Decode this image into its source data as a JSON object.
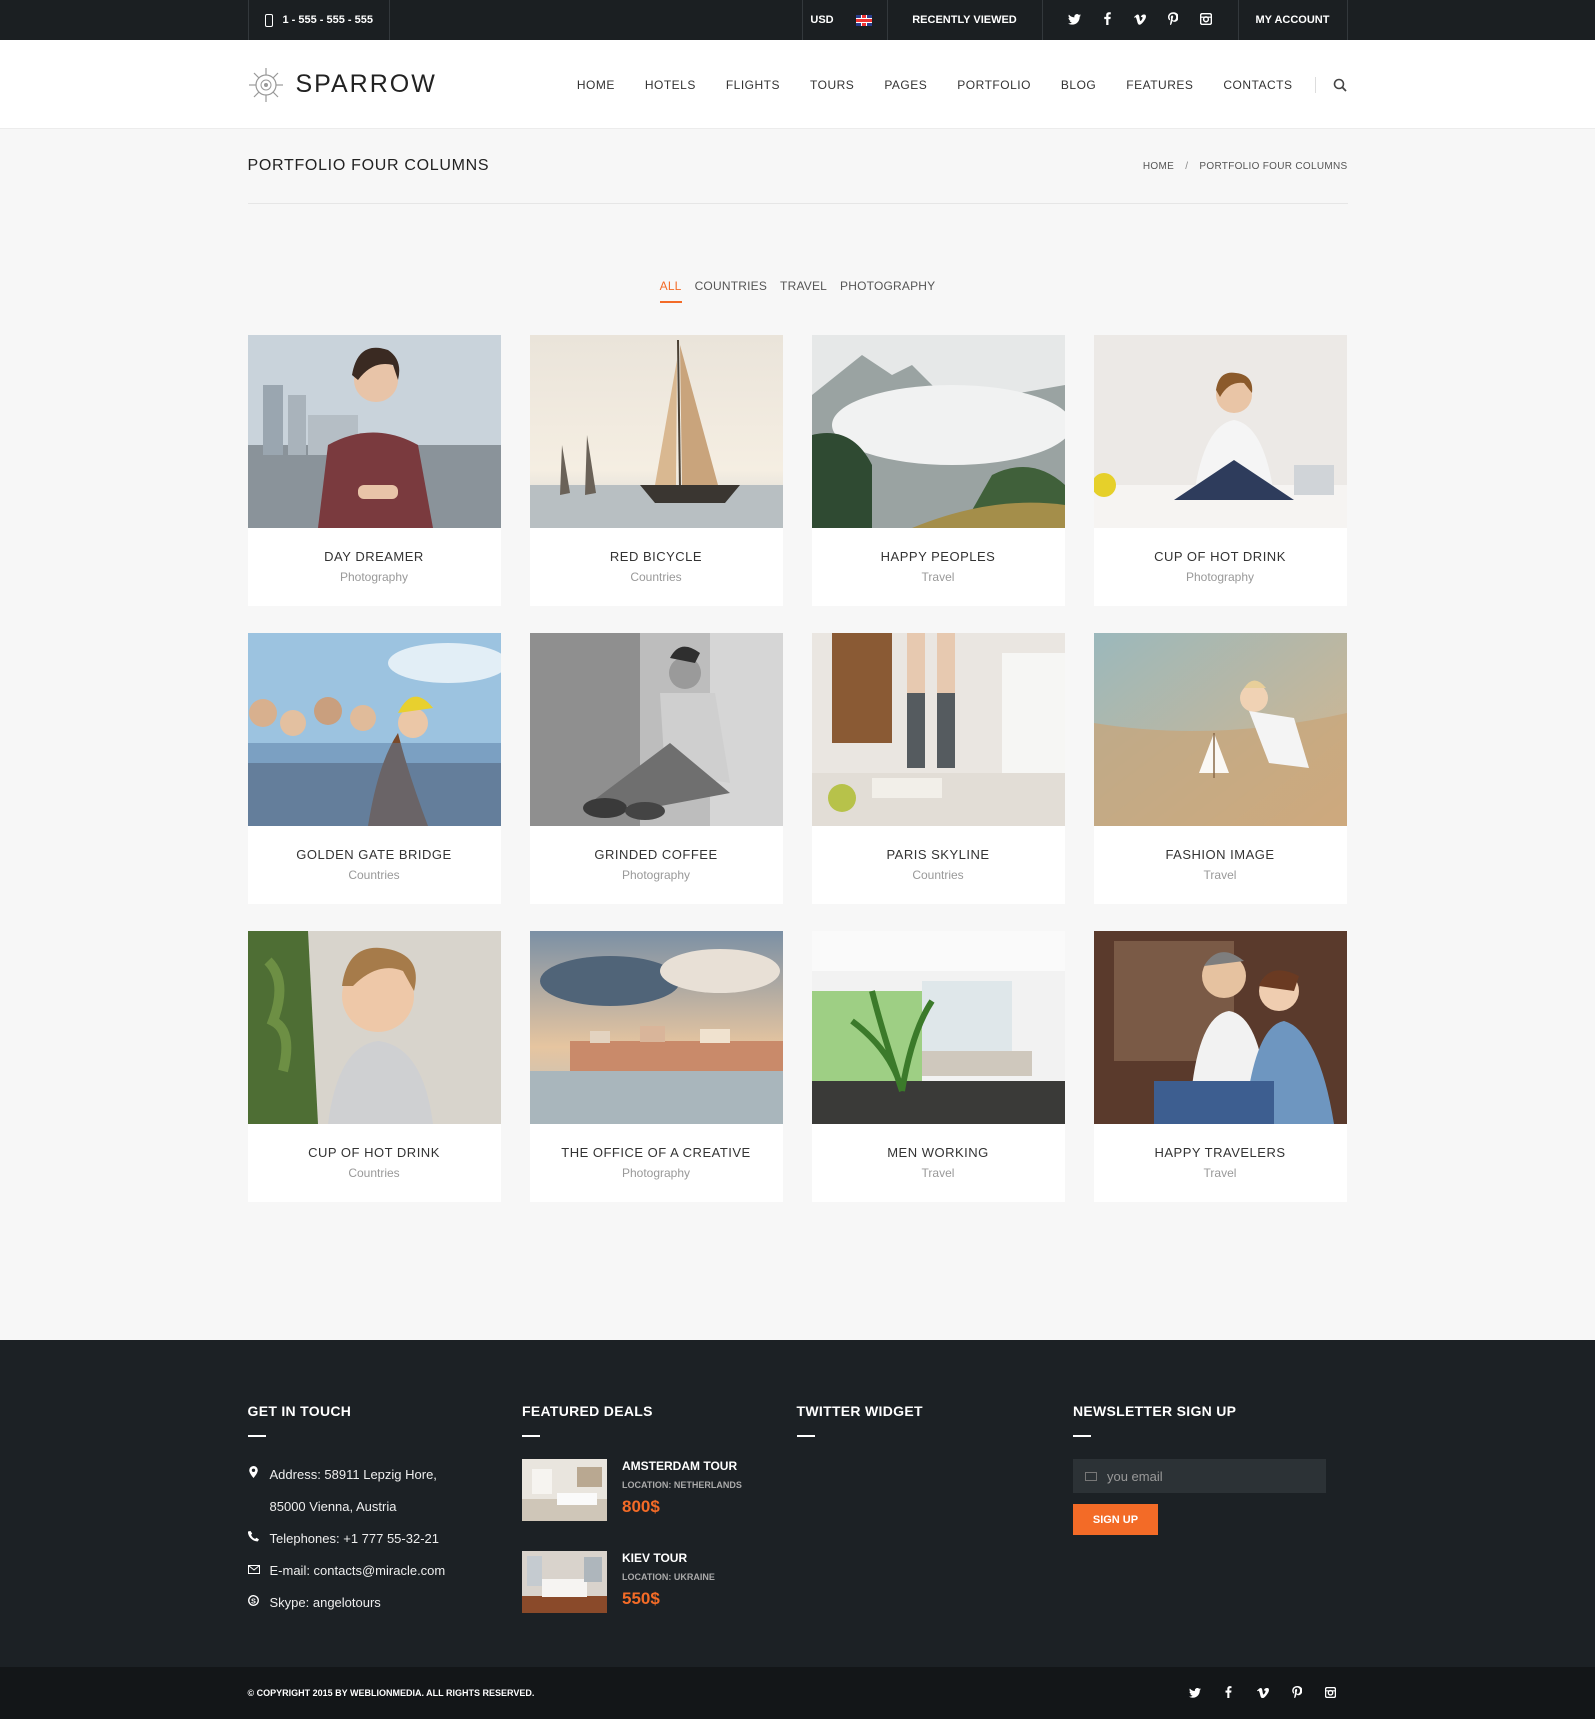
{
  "topbar": {
    "phone": "1 - 555 - 555 - 555",
    "currency": "USD",
    "recently_viewed": "RECENTLY VIEWED",
    "social": [
      "twitter",
      "facebook",
      "vimeo",
      "pinterest",
      "instagram"
    ],
    "social_glyphs": [
      "🐦",
      "f",
      "v",
      "P",
      "◎"
    ],
    "account": "MY ACCOUNT"
  },
  "header": {
    "logo": "SPARROW",
    "nav": [
      "HOME",
      "HOTELS",
      "FLIGHTS",
      "TOURS",
      "PAGES",
      "PORTFOLIO",
      "BLOG",
      "FEATURES",
      "CONTACTS"
    ]
  },
  "page": {
    "title": "PORTFOLIO FOUR COLUMNS",
    "breadcrumb": [
      "HOME",
      "PORTFOLIO FOUR COLUMNS"
    ],
    "breadcrumb_sep": "/"
  },
  "filters": [
    "ALL",
    "COUNTRIES",
    "TRAVEL",
    "PHOTOGRAPHY"
  ],
  "portfolio": [
    {
      "title": "DAY DREAMER",
      "category": "Photography"
    },
    {
      "title": "RED BICYCLE",
      "category": "Countries"
    },
    {
      "title": "HAPPY PEOPLES",
      "category": "Travel"
    },
    {
      "title": "CUP OF HOT DRINK",
      "category": "Photography"
    },
    {
      "title": "GOLDEN GATE BRIDGE",
      "category": "Countries"
    },
    {
      "title": "GRINDED COFFEE",
      "category": "Photography"
    },
    {
      "title": "PARIS SKYLINE",
      "category": "Countries"
    },
    {
      "title": "FASHION IMAGE",
      "category": "Travel"
    },
    {
      "title": "CUP OF HOT DRINK",
      "category": "Countries"
    },
    {
      "title": "THE OFFICE OF A CREATIVE",
      "category": "Photography"
    },
    {
      "title": "MEN WORKING",
      "category": "Travel"
    },
    {
      "title": "HAPPY TRAVELERS",
      "category": "Travel"
    }
  ],
  "footer": {
    "contact": {
      "heading": "GET IN TOUCH",
      "address1": "Address: 58911 Lepzig Hore,",
      "address2": "85000 Vienna, Austria",
      "phone": "Telephones: +1 777 55-32-21",
      "email": "E-mail: contacts@miracle.com",
      "skype": "Skype: angelotours"
    },
    "deals": {
      "heading": "FEATURED DEALS",
      "items": [
        {
          "name": "AMSTERDAM TOUR",
          "location": "LOCATION: NETHERLANDS",
          "price": "800$"
        },
        {
          "name": "KIEV TOUR",
          "location": "LOCATION: UKRAINE",
          "price": "550$"
        }
      ]
    },
    "twitter": {
      "heading": "TWITTER WIDGET"
    },
    "newsletter": {
      "heading": "NEWSLETTER SIGN UP",
      "placeholder": "you email",
      "button": "SIGN UP"
    }
  },
  "copyright": "© COPYRIGHT 2015 BY WEBLIONMEDIA. ALL RIGHTS RESERVED.",
  "colors": {
    "accent": "#f36b27",
    "dark": "#1c2125",
    "topbar": "#1b1f22"
  }
}
